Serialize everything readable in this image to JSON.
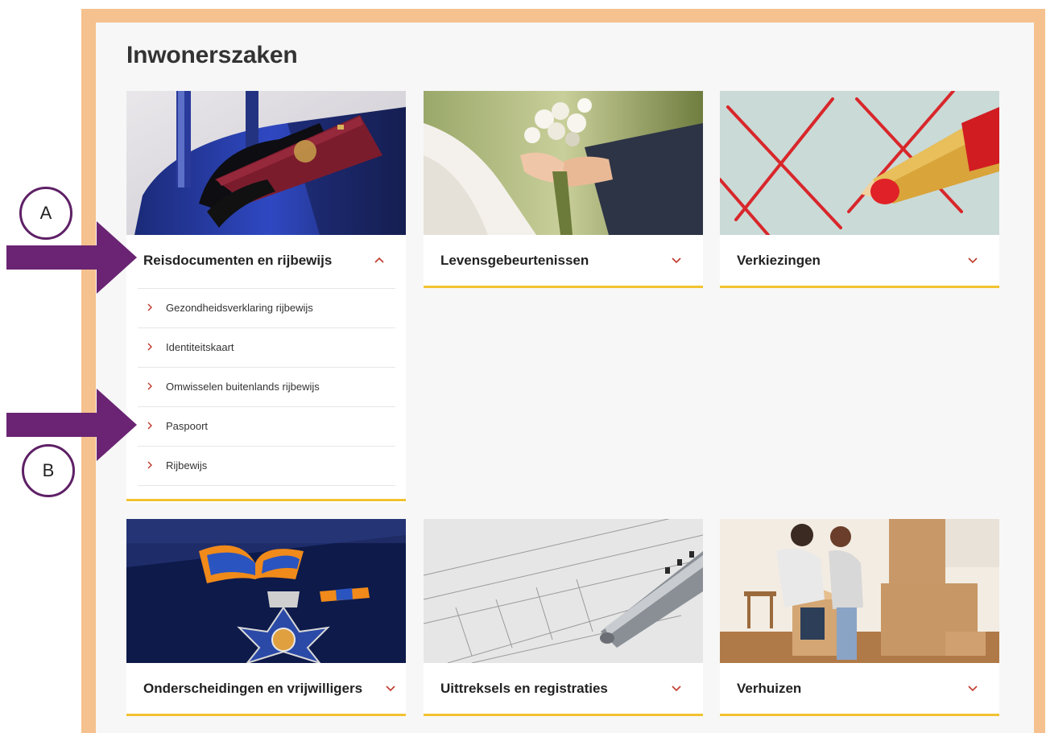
{
  "page": {
    "title": "Inwonerszaken"
  },
  "cards": [
    {
      "id": "reisdocumenten",
      "label": "Reisdocumenten en rijbewijs",
      "expanded": true,
      "image": "suitcase-with-passport",
      "items": [
        "Gezondheidsverklaring rijbewijs",
        "Identiteitskaart",
        "Omwisselen buitenlands rijbewijs",
        "Paspoort",
        "Rijbewijs"
      ]
    },
    {
      "id": "levensgebeurtenissen",
      "label": "Levensgebeurtenissen",
      "expanded": false,
      "image": "wedding-bouquet-hands"
    },
    {
      "id": "verkiezingen",
      "label": "Verkiezingen",
      "expanded": false,
      "image": "red-pencil-crosses"
    },
    {
      "id": "onderscheidingen",
      "label": "Onderscheidingen en vrijwilligers",
      "expanded": false,
      "image": "royal-medal-in-box"
    },
    {
      "id": "uittreksels",
      "label": "Uittreksels en registraties",
      "expanded": false,
      "image": "pen-on-form"
    },
    {
      "id": "verhuizen",
      "label": "Verhuizen",
      "expanded": false,
      "image": "couple-moving-boxes"
    }
  ],
  "annotations": [
    {
      "label": "A",
      "points_to": "Reisdocumenten en rijbewijs"
    },
    {
      "label": "B",
      "points_to": "Paspoort"
    }
  ],
  "colors": {
    "frame": "#f5c18e",
    "accent_underline": "#f2c230",
    "chevron": "#c0392b",
    "annotation": "#5e2066"
  },
  "icons": {
    "expand": "chevron-down-icon",
    "collapse": "chevron-up-icon",
    "item": "chevron-right-icon"
  }
}
